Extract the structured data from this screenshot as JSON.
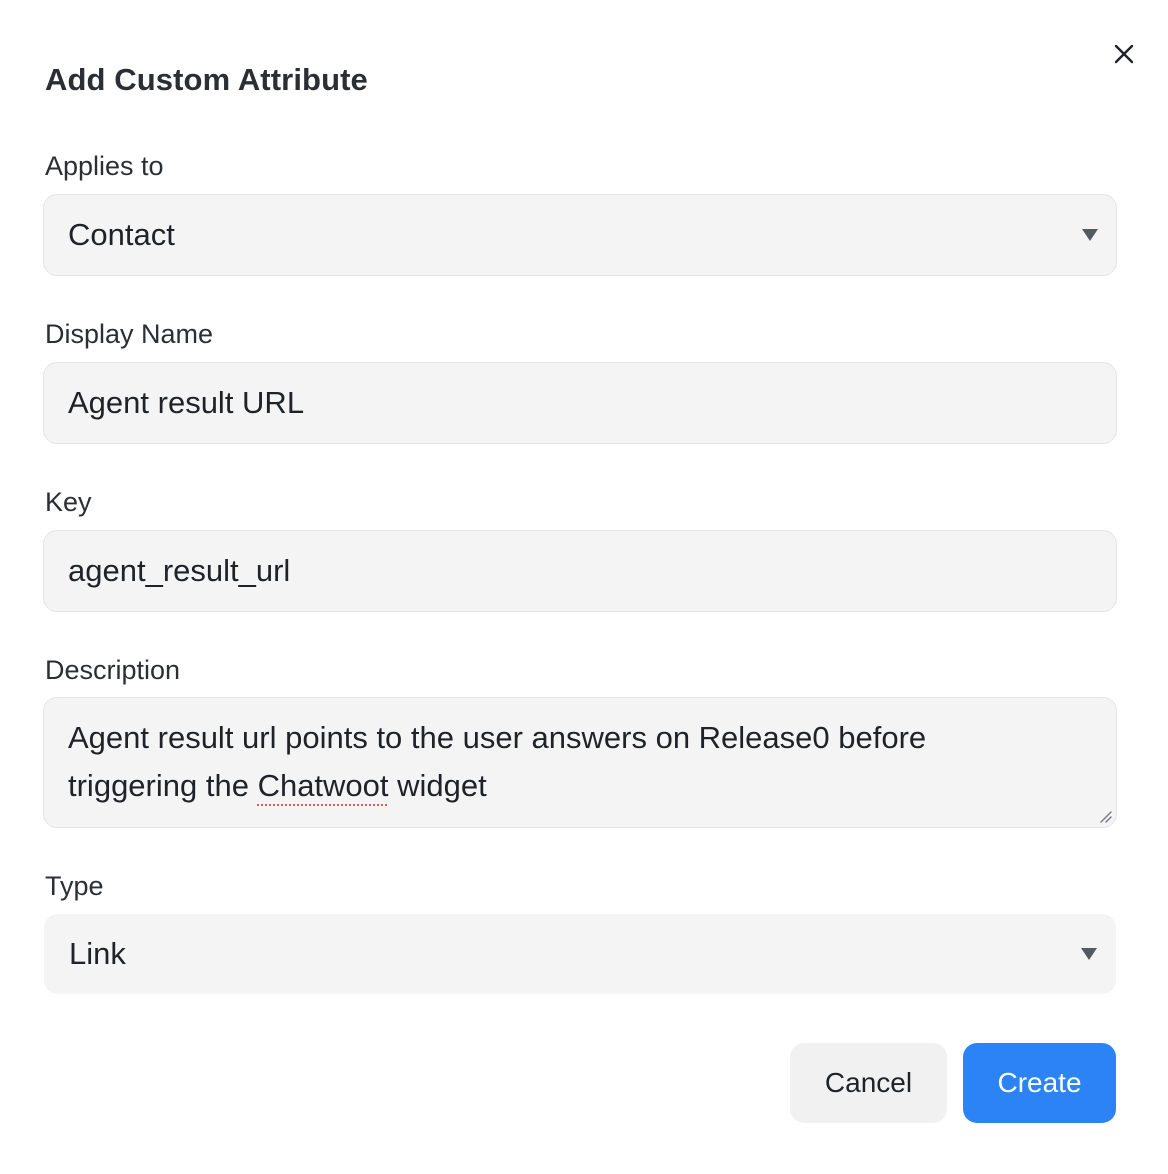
{
  "modal": {
    "title": "Add Custom Attribute",
    "close_icon": "close-icon"
  },
  "form": {
    "applies_to": {
      "label": "Applies to",
      "value": "Contact",
      "caret_icon": "caret-down-icon"
    },
    "display_name": {
      "label": "Display Name",
      "value": "Agent result URL"
    },
    "key": {
      "label": "Key",
      "value": "agent_result_url"
    },
    "description": {
      "label": "Description",
      "value_line1": "Agent result url points to the user answers on Release0 before",
      "value_line2_before": "triggering the ",
      "value_line2_misspelled": "Chatwoot",
      "value_line2_after": " widget",
      "resize_icon": "resize-handle-icon"
    },
    "type": {
      "label": "Type",
      "value": "Link",
      "caret_icon": "caret-down-icon"
    }
  },
  "actions": {
    "cancel_label": "Cancel",
    "create_label": "Create"
  },
  "colors": {
    "primary": "#2b83f6",
    "field_bg": "#f4f4f5",
    "field_border": "#e4e4e7",
    "spellcheck": "#e25a5a"
  }
}
